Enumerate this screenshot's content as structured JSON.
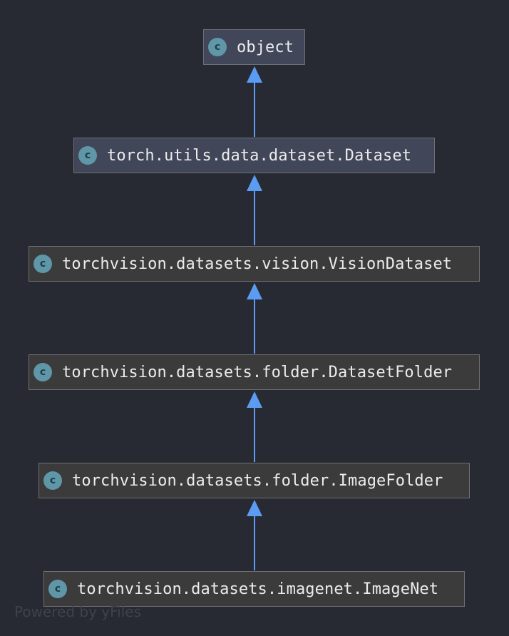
{
  "diagram": {
    "nodes": [
      {
        "label": "object",
        "badge": "c"
      },
      {
        "label": "torch.utils.data.dataset.Dataset",
        "badge": "c"
      },
      {
        "label": "torchvision.datasets.vision.VisionDataset",
        "badge": "c"
      },
      {
        "label": "torchvision.datasets.folder.DatasetFolder",
        "badge": "c"
      },
      {
        "label": "torchvision.datasets.folder.ImageFolder",
        "badge": "c"
      },
      {
        "label": "torchvision.datasets.imagenet.ImageNet",
        "badge": "c"
      }
    ],
    "edges": [
      {
        "from": "torch.utils.data.dataset.Dataset",
        "to": "object"
      },
      {
        "from": "torchvision.datasets.vision.VisionDataset",
        "to": "torch.utils.data.dataset.Dataset"
      },
      {
        "from": "torchvision.datasets.folder.DatasetFolder",
        "to": "torchvision.datasets.vision.VisionDataset"
      },
      {
        "from": "torchvision.datasets.folder.ImageFolder",
        "to": "torchvision.datasets.folder.DatasetFolder"
      },
      {
        "from": "torchvision.datasets.imagenet.ImageNet",
        "to": "torchvision.datasets.folder.ImageFolder"
      }
    ],
    "colors": {
      "background": "#282a33",
      "edge": "#5b9cf2",
      "badge": "#5f97a8"
    }
  },
  "watermark": "Powered by yFiles"
}
